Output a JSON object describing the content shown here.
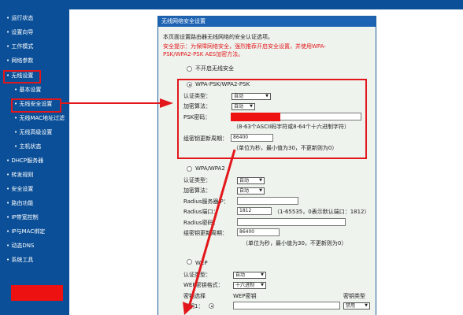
{
  "sidebar": {
    "items": [
      {
        "label": "• 运行状态"
      },
      {
        "label": "• 设置向导"
      },
      {
        "label": "• 工作模式"
      },
      {
        "label": "• 网络参数"
      },
      {
        "label": "• 无线设置"
      },
      {
        "label": "• 基本设置"
      },
      {
        "label": "• 无线安全设置"
      },
      {
        "label": "• 无线MAC地址过滤"
      },
      {
        "label": "• 无线高级设置"
      },
      {
        "label": "• 主机状态"
      },
      {
        "label": "• DHCP服务器"
      },
      {
        "label": "• 转发规则"
      },
      {
        "label": "• 安全设置"
      },
      {
        "label": "• 路由功能"
      },
      {
        "label": "• IP带宽控制"
      },
      {
        "label": "• IP与MAC绑定"
      },
      {
        "label": "• 动态DNS"
      },
      {
        "label": "• 系统工具"
      }
    ],
    "highlight_color": "#e3171b"
  },
  "page": {
    "title": "无线网络安全设置",
    "intro": "本页面设置路由器无线网络的安全认证选项。",
    "tip_line1": "安全提示：为保障网络安全，强烈推荐开启安全设置，并使用WPA-",
    "tip_line2": "PSK/WPA2-PSK AES加密方法。",
    "none_option": "不开启无线安全"
  },
  "wpa_psk": {
    "option": "WPA-PSK/WPA2-PSK",
    "auth_label": "认证类型：",
    "auth_value": "自动",
    "enc_label": "加密算法：",
    "enc_value": "自动",
    "psk_label": "PSK密码：",
    "psk_hint": "（8-63个ASCII码字符或8-64个十六进制字符）",
    "renew_label": "组密钥更新周期：",
    "renew_value": "86400",
    "renew_hint": "（单位为秒，最小值为30，不更新则为0）"
  },
  "wpa": {
    "option": "WPA/WPA2",
    "auth_label": "认证类型：",
    "auth_value": "自动",
    "enc_label": "加密算法：",
    "enc_value": "自动",
    "radius_ip_label": "Radius服务器IP：",
    "radius_port_label": "Radius端口：",
    "radius_port_value": "1812",
    "radius_port_hint": "（1-65535，0表示默认端口：1812）",
    "radius_pwd_label": "Radius密码：",
    "renew_label": "组密钥更新周期：",
    "renew_value": "86400",
    "renew_hint": "（单位为秒，最小值为30，不更新则为0）"
  },
  "wep": {
    "option": "WEP",
    "auth_label": "认证类型：",
    "auth_value": "自动",
    "format_label": "WEP密钥格式：",
    "format_value": "十六进制",
    "col_select": "密钥选择",
    "col_key": "WEP密钥",
    "col_type": "密钥类型",
    "key1_label": "密钥1：",
    "key1_type": "禁用"
  },
  "annotations": {
    "arrow_color": "#e3171b"
  }
}
